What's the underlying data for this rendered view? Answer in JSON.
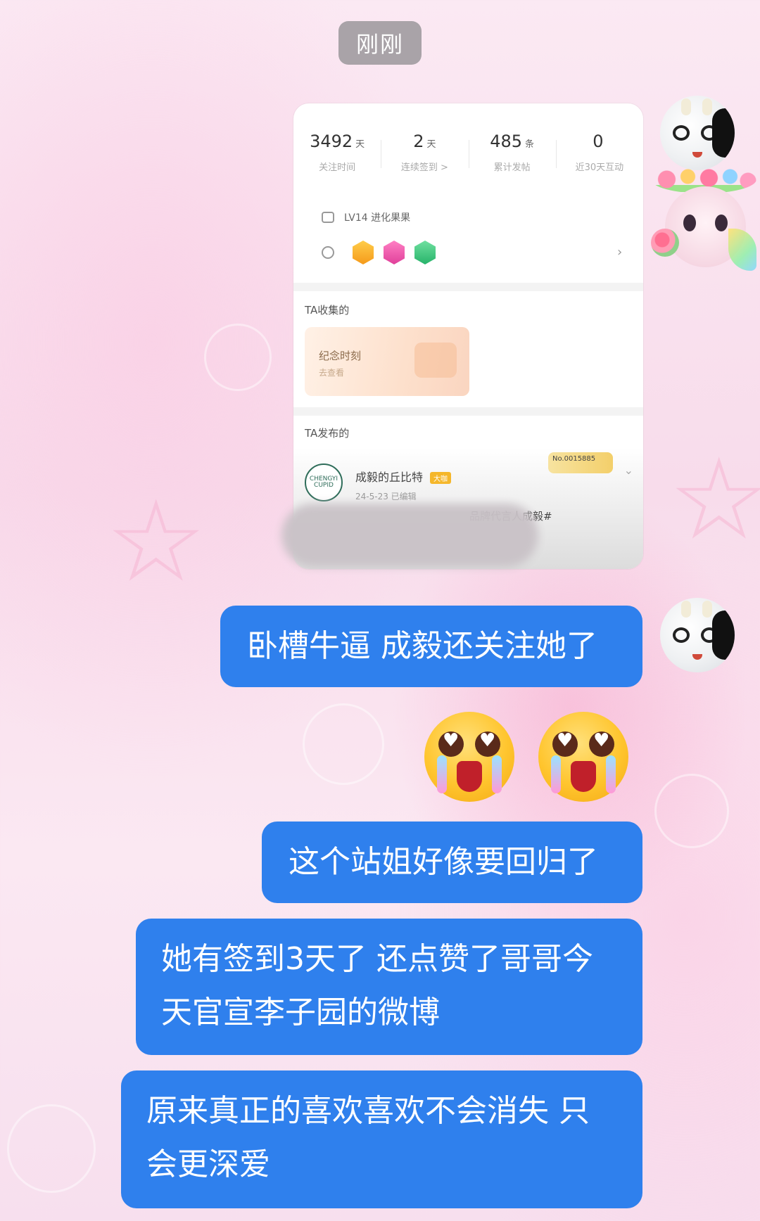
{
  "timestamp": "刚刚",
  "shared_screenshot": {
    "stats": [
      {
        "value": "3492",
        "unit": "天",
        "label": "关注时间"
      },
      {
        "value": "2",
        "unit": "天",
        "label": "连续签到 >"
      },
      {
        "value": "485",
        "unit": "条",
        "label": "累计发帖"
      },
      {
        "value": "0",
        "unit": "",
        "label": "近30天互动"
      }
    ],
    "level": "LV14 进化果果",
    "chevron": "›",
    "collected_title": "TA收集的",
    "memory_card": {
      "title": "纪念时刻",
      "subtitle": "去查看"
    },
    "posted_title": "TA发布的",
    "post": {
      "avatar_text": "CHENGYI CUPID",
      "author": "成毅的丘比特",
      "vip": "大咖",
      "date": "24-5-23  已编辑",
      "number": "No.0015885",
      "snippet": "品牌代言人成毅#"
    }
  },
  "messages": [
    {
      "id": "m1",
      "text": "卧槽牛逼 成毅还关注她了"
    },
    {
      "id": "m2",
      "text": "这个站姐好像要回归了"
    },
    {
      "id": "m3",
      "lines": [
        "她有签到3天了 还点赞了哥哥今",
        "天官宣李子园的微博"
      ]
    },
    {
      "id": "m4",
      "lines": [
        "原来真正的喜欢喜欢不会消失 只",
        "会更深爱"
      ]
    }
  ],
  "colors": {
    "bubble": "#2f80ed",
    "time_pill": "#a9a3a8"
  },
  "icons": [
    "user-avatar",
    "crying-heart-eyes-emoji",
    "settings-icon",
    "badge-icon",
    "chevron-right-icon"
  ]
}
